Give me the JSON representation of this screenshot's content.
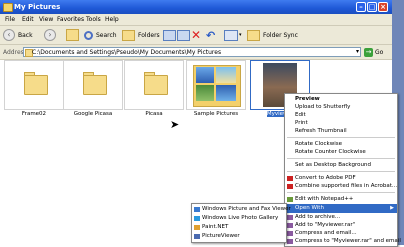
{
  "window": {
    "title": "My Pictures"
  },
  "menubar": [
    "File",
    "Edit",
    "View",
    "Favorites",
    "Tools",
    "Help"
  ],
  "toolbar": {
    "back": "Back",
    "search": "Search",
    "folders": "Folders",
    "folder_sync": "Folder Sync"
  },
  "address": {
    "label": "Address",
    "value": "C:\\Documents and Settings\\Pseudo\\My Documents\\My Pictures",
    "go": "Go"
  },
  "items": [
    {
      "label": "Frame02"
    },
    {
      "label": "Google Picasa"
    },
    {
      "label": "Picasa"
    },
    {
      "label": "Sample Pictures"
    },
    {
      "label": "Myviewer"
    }
  ],
  "context_menu": [
    "Preview",
    "Upload to Shutterfly",
    "Edit",
    "Print",
    "Refresh Thumbnail",
    "Rotate Clockwise",
    "Rotate Counter Clockwise",
    "Set as Desktop Background",
    "Convert to Adobe PDF",
    "Combine supported files in Acrobat...",
    "Edit with Notepad++",
    "Open With",
    "Add to archive...",
    "Add to \"Myviewer.rar\"",
    "Compress and email...",
    "Compress to \"Myviewer.rar\" and email"
  ],
  "submenu": [
    "Windows Picture and Fax Viewer",
    "Windows Live Photo Gallery",
    "Paint.NET",
    "PictureViewer"
  ],
  "colors": {
    "titlebar": "#1f58d6",
    "highlight": "#316ac5",
    "window_bg": "#ece9d8"
  }
}
